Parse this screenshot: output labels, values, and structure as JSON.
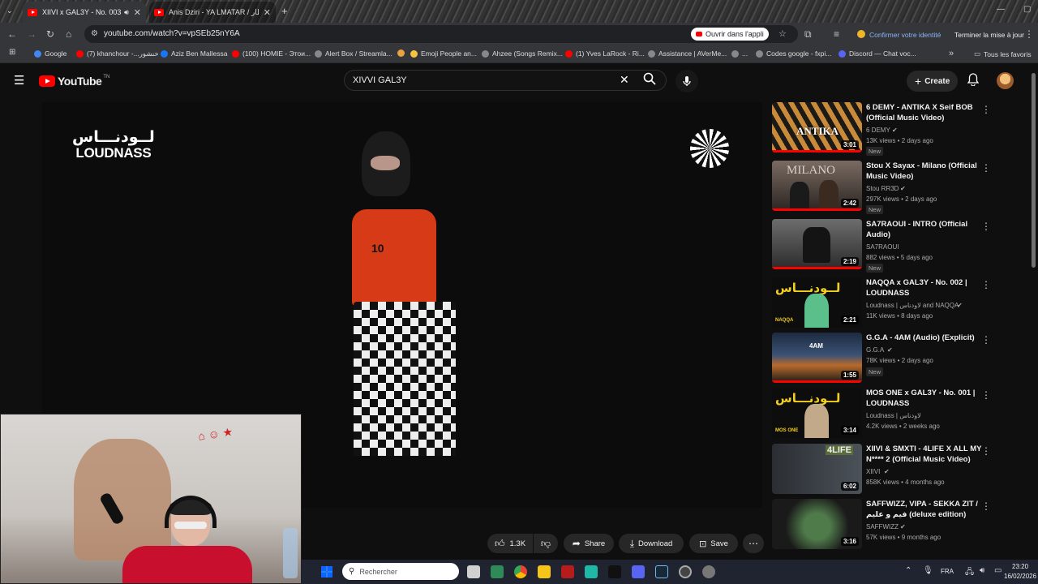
{
  "browser": {
    "tabs": [
      {
        "title": "XIIVI x GAL3Y - No. 003 | LOUDNASS",
        "close": "✕"
      },
      {
        "title": "Anis Dziri - YA LMATAR / المطار",
        "close": "✕"
      }
    ],
    "new_tab": "+",
    "url": "youtube.com/watch?v=vpSEb25nY6A",
    "open_in_app": "Ouvrir dans l'appli",
    "confirm_identity": "Confirmer votre identité",
    "finish_update": "Terminer la mise à jour",
    "bookmarks": [
      {
        "label": "Google",
        "color": "#4285f4"
      },
      {
        "label": "(7) khanchour -...خنشور",
        "color": "#ff0000"
      },
      {
        "label": "Aziz Ben Mallessa",
        "color": "#1877f2"
      },
      {
        "label": "(100) HOMIE - Этои...",
        "color": "#ff0000"
      },
      {
        "label": "Alert Box / Streamla...",
        "color": "#888888"
      },
      {
        "label": "",
        "color": "#e8a33d"
      },
      {
        "label": "Emoji People an...",
        "color": "#f5c542"
      },
      {
        "label": "Ahzee (Songs Remix...",
        "color": "#888888"
      },
      {
        "label": "(1) Yves LaRock - Ri...",
        "color": "#ff0000"
      },
      {
        "label": "Assistance | AVerMe...",
        "color": "#888888"
      },
      {
        "label": "...",
        "color": "#888888"
      },
      {
        "label": "Codes google - fxpi...",
        "color": "#888888"
      },
      {
        "label": "Discord — Chat voc...",
        "color": "#5865f2"
      }
    ],
    "more_bookmarks": "»",
    "all_favorites": "Tous les favoris"
  },
  "youtube": {
    "logo": "YouTube",
    "logo_region": "TN",
    "search_query": "XIVVI GAL3Y",
    "create": "Create"
  },
  "video": {
    "watermark_arabic": "لــودنـــاس",
    "watermark_latin": "LOUDNASS",
    "jersey_number": "10"
  },
  "actions": {
    "likes": "1.3K",
    "share": "Share",
    "download": "Download",
    "save": "Save"
  },
  "sidebar": [
    {
      "title": "6 DEMY - ANTIKA X Seif BOB (Official Music Video)",
      "channel": "6 DEMY",
      "verified": true,
      "meta": "13K views • 2 days ago",
      "new": "New",
      "duration": "3:01",
      "thumb_text": "ANTIKA",
      "progress": 1.0
    },
    {
      "title": "Stou X Sayax - Milano (Official Music Video)",
      "channel": "Stou RR3D",
      "verified": true,
      "meta": "297K views • 2 days ago",
      "new": "New",
      "duration": "2:42",
      "thumb_text": "MILANO",
      "progress": 1.0
    },
    {
      "title": "SA7RAOUI - INTRO (Official Audio)",
      "channel": "SA7RAOUI",
      "verified": false,
      "meta": "882 views • 5 days ago",
      "new": "New",
      "duration": "2:19",
      "thumb_text": "",
      "progress": 1.0
    },
    {
      "title": "NAQQA x GAL3Y - No. 002 | LOUDNASS",
      "channel": "Loudnass | لاودناس and NAQQA",
      "verified": true,
      "meta": "11K views • 8 days ago",
      "new": "",
      "duration": "2:21",
      "thumb_text": "لــودنـــاس",
      "thumb_caption": "NAQQA",
      "progress": 0
    },
    {
      "title": "G.G.A - 4AM (Audio) (Explicit)",
      "channel": "G.G.A",
      "verified": true,
      "meta": "78K views • 2 days ago",
      "new": "New",
      "duration": "1:55",
      "thumb_text": "4AM",
      "progress": 1.0
    },
    {
      "title": "MOS ONE x GAL3Y - No. 001 | LOUDNASS",
      "channel": "Loudnass | لاودناس",
      "verified": false,
      "meta": "4.2K views • 2 weeks ago",
      "new": "",
      "duration": "3:14",
      "thumb_text": "لــودنـــاس",
      "thumb_caption": "MOS ONE",
      "progress": 0
    },
    {
      "title": "XIIVI & SMXTI - 4LIFE X ALL MY N**** 2 (Official Music Video)",
      "channel": "XIIVI",
      "verified": true,
      "meta": "858K views • 4 months ago",
      "new": "",
      "duration": "6:02",
      "thumb_text": "4LIFE",
      "progress": 0
    },
    {
      "title": "SAFFWIZZ, VIPA - SEKKA ZIT / فيم و عليم (deluxe edition)",
      "channel": "SAFFWIZZ",
      "verified": true,
      "meta": "57K views • 9 months ago",
      "new": "",
      "duration": "3:16",
      "thumb_text": "",
      "progress": 0
    }
  ],
  "taskbar": {
    "search_placeholder": "Rechercher",
    "lang": "FRA",
    "time": "23:20",
    "date": "16/02/2026"
  },
  "colors": {
    "accent": "#ff0000",
    "background": "#0f0f0f",
    "pill": "#272727"
  }
}
